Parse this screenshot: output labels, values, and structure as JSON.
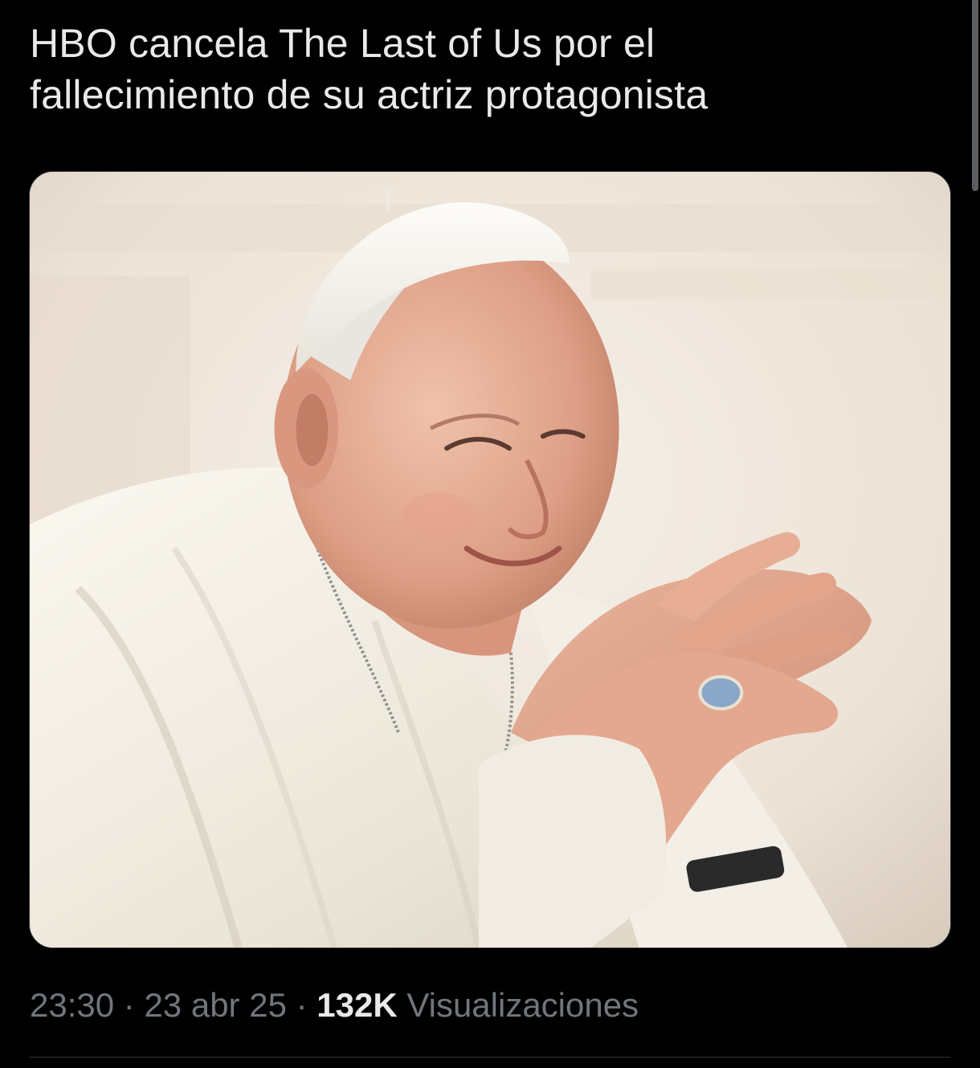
{
  "tweet": {
    "text_line1": "HBO cancela The Last of Us por el",
    "text_line2": "fallecimiento de su actriz protagonista"
  },
  "media": {
    "description_icon": "photo-icon",
    "background_color": "#efe8de"
  },
  "meta": {
    "time": "23:30",
    "separator": "·",
    "date": "23 abr 25",
    "views_count": "132K",
    "views_label": "Visualizaciones"
  },
  "colors": {
    "background": "#000000",
    "text_primary": "#e7e9ea",
    "text_secondary": "#71767b",
    "border": "#2f3336"
  }
}
